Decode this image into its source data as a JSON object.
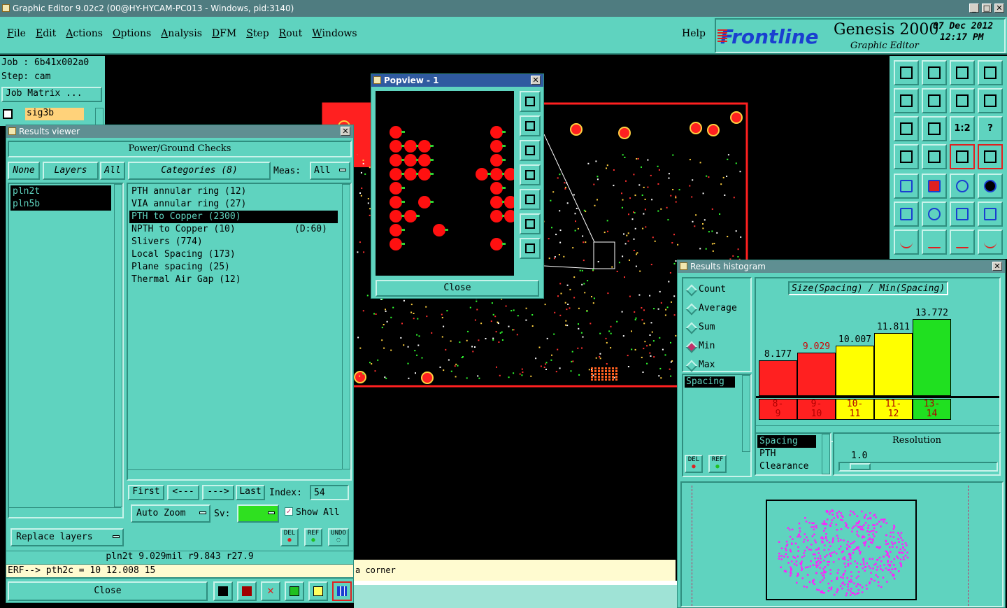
{
  "window": {
    "title": "Graphic Editor 9.02c2 (00@HY-HYCAM-PC013 - Windows, pid:3140)"
  },
  "menu": [
    "File",
    "Edit",
    "Actions",
    "Options",
    "Analysis",
    "DFM",
    "Step",
    "Rout",
    "Windows"
  ],
  "help_label": "Help",
  "brand": {
    "logo": "Frontline",
    "product": "Genesis 2000",
    "subtitle": "Graphic Editor",
    "date": "07  Dec  2012",
    "time": "12:17  PM"
  },
  "job": {
    "job_line": "Job  :  6b41x002a0",
    "step_line": "Step:  cam",
    "matrix_button": "Job Matrix  ...",
    "layer_name": "sig3b"
  },
  "results_viewer": {
    "title": "Results viewer",
    "header": "Power/Ground Checks",
    "none_label": "None",
    "layers_label": "Layers",
    "all_label": "All",
    "categories_label": "Categories (8)",
    "meas_label": "Meas:",
    "meas_value": "All",
    "layers": [
      "pln2t",
      "pln5b"
    ],
    "categories": [
      {
        "name": "PTH annular ring (12)",
        "extra": ""
      },
      {
        "name": "VIA annular ring (27)",
        "extra": ""
      },
      {
        "name": "PTH to Copper (2300)",
        "extra": ""
      },
      {
        "name": "NPTH to Copper (10)",
        "extra": "(D:60)"
      },
      {
        "name": "Slivers (774)",
        "extra": ""
      },
      {
        "name": "Local Spacing (173)",
        "extra": ""
      },
      {
        "name": "Plane spacing (25)",
        "extra": ""
      },
      {
        "name": "Thermal Air Gap (12)",
        "extra": ""
      }
    ],
    "nav": {
      "first": "First",
      "prev": "<---",
      "next": "--->",
      "last": "Last",
      "index_label": "Index:",
      "index_value": "54"
    },
    "auto_zoom": "Auto Zoom",
    "sv_label": "Sv:",
    "show_all": "Show All",
    "replace_layers": "Replace layers",
    "del_label": "DEL",
    "ref_label": "REF",
    "undo_label": "UNDO",
    "status_line": "pln2t  9.029mil   r9.843   r27.9",
    "erf_line": "ERF-->  pth2c  =  10  12.008  15",
    "close_label": "Close"
  },
  "popview": {
    "title": "Popview - 1",
    "close_label": "Close"
  },
  "message_text": "a corner",
  "histogram": {
    "title": "Results histogram",
    "options": [
      {
        "label": "Count",
        "selected": false
      },
      {
        "label": "Average",
        "selected": false
      },
      {
        "label": "Sum",
        "selected": false
      },
      {
        "label": "Min",
        "selected": true
      },
      {
        "label": "Max",
        "selected": false
      }
    ],
    "list_item": "Spacing",
    "del_label": "DEL",
    "ref_label": "REF",
    "header": "Size(Spacing) / Min(Spacing)",
    "bars": [
      {
        "value": "8.177",
        "range": "8-\n9",
        "height": 0.46,
        "color": "#ff2020",
        "label_color": "#000000"
      },
      {
        "value": "9.029",
        "range": "9-\n10",
        "height": 0.56,
        "color": "#ff2020",
        "label_color": "#d00000"
      },
      {
        "value": "10.007",
        "range": "10-\n11",
        "height": 0.65,
        "color": "#ffff00",
        "label_color": "#000000"
      },
      {
        "value": "11.811",
        "range": "11-\n12",
        "height": 0.82,
        "color": "#ffff00",
        "label_color": "#000000"
      },
      {
        "value": "13.772",
        "range": "13-\n14",
        "height": 1.0,
        "color": "#20e020",
        "label_color": "#000000"
      }
    ],
    "type_list": [
      "Spacing",
      "PTH",
      "Clearance"
    ],
    "resolution_label": "Resolution",
    "resolution_value": "1.0"
  }
}
